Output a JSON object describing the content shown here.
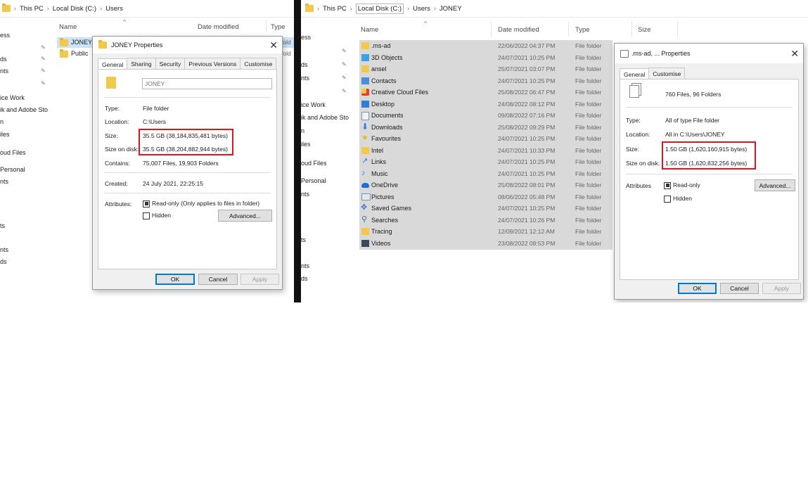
{
  "left_panel": {
    "breadcrumb": [
      "This PC",
      "Local Disk (C:)",
      "Users"
    ],
    "nav_items": [
      "ess",
      "ds",
      "nts",
      "ice Work",
      "ik and Adobe Sto",
      "n",
      "iles",
      "oud Files",
      "Personal",
      "nts",
      "ts",
      "nts",
      "ds"
    ],
    "columns": {
      "name": "Name",
      "date": "Date modified",
      "type": "Type"
    },
    "files": [
      {
        "name": "JONEY",
        "type_clip": "fold"
      },
      {
        "name": "Public",
        "type_clip": "fold"
      }
    ],
    "dialog": {
      "title": "JONEY Properties",
      "tabs": [
        "General",
        "Sharing",
        "Security",
        "Previous Versions",
        "Customise"
      ],
      "folder_name": "JONEY",
      "type_label": "Type:",
      "type_value": "File folder",
      "location_label": "Location:",
      "location_value": "C:\\Users",
      "size_label": "Size:",
      "size_value": "35.5 GB (38,184,835,481 bytes)",
      "size_on_disk_label": "Size on disk:",
      "size_on_disk_value": "35.5 GB (38,204,882,944 bytes)",
      "contains_label": "Contains:",
      "contains_value": "75,007 Files, 19,903 Folders",
      "created_label": "Created:",
      "created_value": "24 July 2021, 22:25:15",
      "attributes_label": "Attributes:",
      "readonly_label": "Read-only (Only applies to files in folder)",
      "hidden_label": "Hidden",
      "advanced_label": "Advanced...",
      "ok_label": "OK",
      "cancel_label": "Cancel",
      "apply_label": "Apply"
    }
  },
  "right_panel": {
    "breadcrumb": [
      "This PC",
      "Local Disk (C:)",
      "Users",
      "JONEY"
    ],
    "nav_items": [
      "ess",
      "ds",
      "nts",
      "ice Work",
      "ik and Adobe Sto",
      "n",
      "iles",
      "oud Files",
      "Personal",
      "nts",
      "ts",
      "nts",
      "ds"
    ],
    "columns": {
      "name": "Name",
      "date": "Date modified",
      "type": "Type",
      "size": "Size"
    },
    "files": [
      {
        "name": ".ms-ad",
        "date": "22/06/2022 04:37 PM",
        "type": "File folder",
        "icon": "folder-icon"
      },
      {
        "name": "3D Objects",
        "date": "24/07/2021 10:25 PM",
        "type": "File folder",
        "icon": "3d-objects-icon"
      },
      {
        "name": "ansel",
        "date": "25/07/2021 03:07 PM",
        "type": "File folder",
        "icon": "folder-icon"
      },
      {
        "name": "Contacts",
        "date": "24/07/2021 10:25 PM",
        "type": "File folder",
        "icon": "contacts-icon"
      },
      {
        "name": "Creative Cloud Files",
        "date": "25/08/2022 06:47 PM",
        "type": "File folder",
        "icon": "creative-cloud-icon"
      },
      {
        "name": "Desktop",
        "date": "24/08/2022 08:12 PM",
        "type": "File folder",
        "icon": "desktop-icon"
      },
      {
        "name": "Documents",
        "date": "09/08/2022 07:16 PM",
        "type": "File folder",
        "icon": "documents-icon"
      },
      {
        "name": "Downloads",
        "date": "25/08/2022 09:29 PM",
        "type": "File folder",
        "icon": "downloads-icon"
      },
      {
        "name": "Favourites",
        "date": "24/07/2021 10:25 PM",
        "type": "File folder",
        "icon": "favourites-icon"
      },
      {
        "name": "Intel",
        "date": "24/07/2021 10:33 PM",
        "type": "File folder",
        "icon": "folder-icon"
      },
      {
        "name": "Links",
        "date": "24/07/2021 10:25 PM",
        "type": "File folder",
        "icon": "links-icon"
      },
      {
        "name": "Music",
        "date": "24/07/2021 10:25 PM",
        "type": "File folder",
        "icon": "music-icon"
      },
      {
        "name": "OneDrive",
        "date": "25/08/2022 08:01 PM",
        "type": "File folder",
        "icon": "onedrive-icon"
      },
      {
        "name": "Pictures",
        "date": "08/06/2022 05:48 PM",
        "type": "File folder",
        "icon": "pictures-icon"
      },
      {
        "name": "Saved Games",
        "date": "24/07/2021 10:25 PM",
        "type": "File folder",
        "icon": "saved-games-icon"
      },
      {
        "name": "Searches",
        "date": "24/07/2021 10:26 PM",
        "type": "File folder",
        "icon": "searches-icon"
      },
      {
        "name": "Tracing",
        "date": "12/09/2021 12:12 AM",
        "type": "File folder",
        "icon": "folder-icon"
      },
      {
        "name": "Videos",
        "date": "23/08/2022 08:53 PM",
        "type": "File folder",
        "icon": "videos-icon"
      }
    ],
    "dialog": {
      "title": ".ms-ad, ... Properties",
      "tabs": [
        "General",
        "Customise"
      ],
      "summary": "760 Files, 96 Folders",
      "type_label": "Type:",
      "type_value": "All of type File folder",
      "location_label": "Location:",
      "location_value": "All in C:\\Users\\JONEY",
      "size_label": "Size:",
      "size_value": "1.50 GB (1,620,160,915 bytes)",
      "size_on_disk_label": "Size on disk:",
      "size_on_disk_value": "1.50 GB (1,620,832,256 bytes)",
      "attributes_label": "Attributes",
      "readonly_label": "Read-only",
      "hidden_label": "Hidden",
      "advanced_label": "Advanced...",
      "ok_label": "OK",
      "cancel_label": "Cancel",
      "apply_label": "Apply"
    }
  },
  "colors": {
    "highlight_box": "#e0141e",
    "selection": "#d9d9d9",
    "divider": "#111111"
  }
}
